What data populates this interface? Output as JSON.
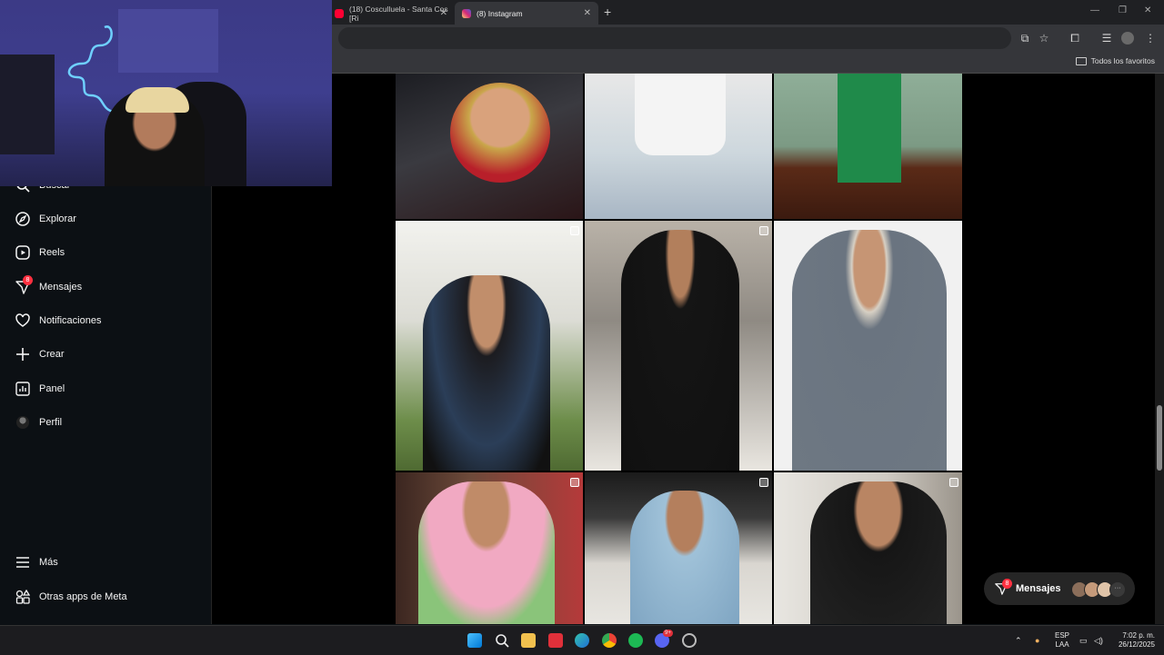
{
  "browser": {
    "tabs": [
      {
        "label": "(18) Cosculluela - Santa Cos [Ri",
        "active": false
      },
      {
        "label": "(8) Instagram",
        "active": true
      }
    ],
    "new_tab": "+",
    "bookmarks_label": "Todos los favoritos"
  },
  "sidebar": {
    "items": [
      {
        "label": "Buscar",
        "icon": "search-icon"
      },
      {
        "label": "Explorar",
        "icon": "compass-icon"
      },
      {
        "label": "Reels",
        "icon": "reels-icon"
      },
      {
        "label": "Mensajes",
        "icon": "messenger-icon",
        "badge": "8"
      },
      {
        "label": "Notificaciones",
        "icon": "heart-icon"
      },
      {
        "label": "Crear",
        "icon": "plus-icon"
      },
      {
        "label": "Panel",
        "icon": "chart-icon"
      },
      {
        "label": "Perfil",
        "icon": "avatar"
      }
    ],
    "more": "Más",
    "meta_apps": "Otras apps de Meta"
  },
  "messages_pill": {
    "label": "Mensajes",
    "badge": "8",
    "more": "···"
  },
  "taskbar": {
    "lang": "ESP",
    "lang_sub": "LAA",
    "time": "7:02 p. m.",
    "date": "26/12/2025",
    "discord_badge": "9+"
  },
  "colors": {
    "accent_badge": "#ff3040",
    "instagram_bg": "#000000"
  }
}
